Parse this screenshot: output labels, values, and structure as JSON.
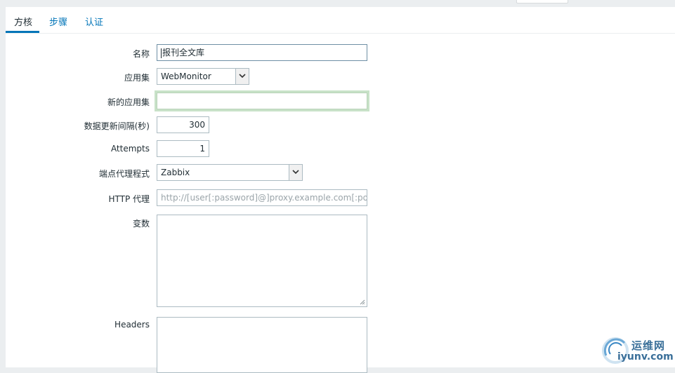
{
  "tabs": [
    {
      "label": "方核",
      "active": true
    },
    {
      "label": "步骤",
      "active": false
    },
    {
      "label": "认证",
      "active": false
    }
  ],
  "form": {
    "name": {
      "label": "名称",
      "value": "报刊全文库"
    },
    "application": {
      "label": "应用集",
      "selected": "WebMonitor"
    },
    "new_application": {
      "label": "新的应用集",
      "value": ""
    },
    "update_interval": {
      "label": "数据更新间隔(秒)",
      "value": "300"
    },
    "attempts": {
      "label": "Attempts",
      "value": "1"
    },
    "agent": {
      "label": "端点代理程式",
      "selected": "Zabbix"
    },
    "http_proxy": {
      "label": "HTTP 代理",
      "placeholder": "http://[user[:password]@]proxy.example.com[:port]"
    },
    "variables": {
      "label": "变数",
      "value": ""
    },
    "headers": {
      "label": "Headers",
      "value": ""
    }
  },
  "watermark": {
    "cn": "运维网",
    "en": "iyunv.com"
  },
  "colors": {
    "link": "#0275b8",
    "text": "#1f2c33",
    "border": "#acbbc2",
    "background": "#ebeef0",
    "focus_glow": "#c8e2c8"
  }
}
